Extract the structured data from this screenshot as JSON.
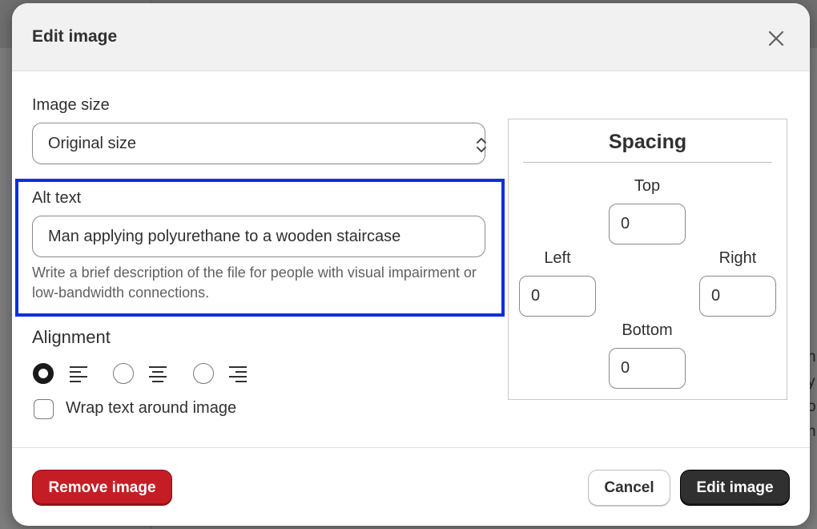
{
  "modal": {
    "title": "Edit image"
  },
  "image_size": {
    "label": "Image size",
    "selected": "Original size"
  },
  "alt_text": {
    "label": "Alt text",
    "value": "Man applying polyurethane to a wooden staircase",
    "help": "Write a brief description of the file for people with visual impairment or low-bandwidth connections."
  },
  "alignment": {
    "label": "Alignment",
    "options": [
      {
        "icon": "align-left-icon",
        "checked": true
      },
      {
        "icon": "align-center-icon",
        "checked": false
      },
      {
        "icon": "align-right-icon",
        "checked": false
      }
    ]
  },
  "wrap": {
    "label": "Wrap text around image",
    "checked": false
  },
  "spacing": {
    "title": "Spacing",
    "top_label": "Top",
    "top_value": "0",
    "left_label": "Left",
    "left_value": "0",
    "right_label": "Right",
    "right_value": "0",
    "bottom_label": "Bottom",
    "bottom_value": "0"
  },
  "footer": {
    "remove_label": "Remove image",
    "cancel_label": "Cancel",
    "confirm_label": "Edit image"
  },
  "background": {
    "peek_lines": [
      "n",
      "y",
      "o",
      "n"
    ]
  },
  "colors": {
    "highlight": "#0a2fe0",
    "danger": "#c51d25",
    "primary": "#303030"
  }
}
